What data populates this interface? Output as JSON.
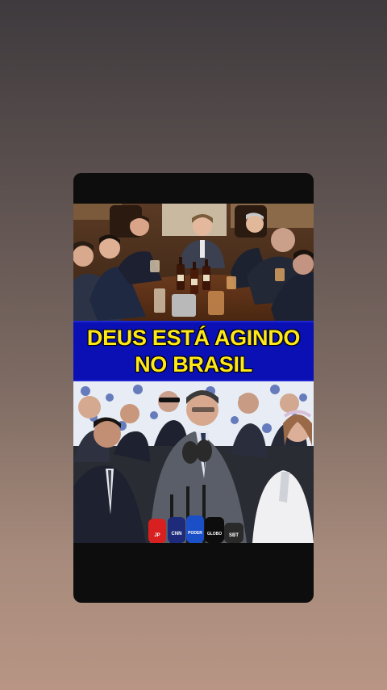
{
  "background": {
    "top_color": "#3e3a3d",
    "bottom_color": "#b89585"
  },
  "post": {
    "banner": {
      "line1": "DEUS ESTÁ AGINDO",
      "line2": "NO BRASIL",
      "background_color": "#0a10b4",
      "text_color": "#ffe81a"
    },
    "top_image": {
      "name": "men-toasting-at-table-photo"
    },
    "bottom_image": {
      "name": "press-conference-photo",
      "microphone_labels": [
        "JOVEM PAN NEWS",
        "CNN",
        "PODER",
        "GLOBO",
        "SBT"
      ]
    }
  }
}
